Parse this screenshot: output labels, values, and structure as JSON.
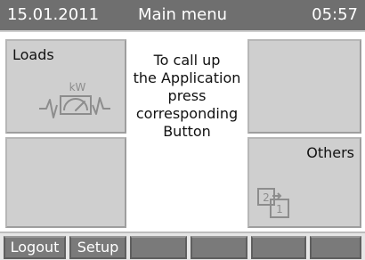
{
  "status_bar": {
    "date": "15.01.2011",
    "title": "Main menu",
    "time": "05:57"
  },
  "tiles": {
    "left_top": {
      "label": "Loads",
      "icon": "kw-meter-icon",
      "icon_text": "kW"
    },
    "left_bottom": {
      "label": ""
    },
    "right_top": {
      "label": ""
    },
    "right_bottom": {
      "label": "Others",
      "icon": "swap-2-1-icon",
      "icon_text": "2 1"
    }
  },
  "hint": {
    "line1": "To call up",
    "line2": "the Application",
    "line3": "press",
    "line4": "corresponding",
    "line5": "Button"
  },
  "bottom_buttons": {
    "logout": "Logout",
    "setup": "Setup",
    "b3": "",
    "b4": "",
    "b5": "",
    "b6": ""
  },
  "colors": {
    "topbar_bg": "#6f6f6f",
    "tile_bg": "#cfcfcf",
    "button_bg": "#7a7a7a",
    "icon_gray": "#8d8d8d"
  }
}
